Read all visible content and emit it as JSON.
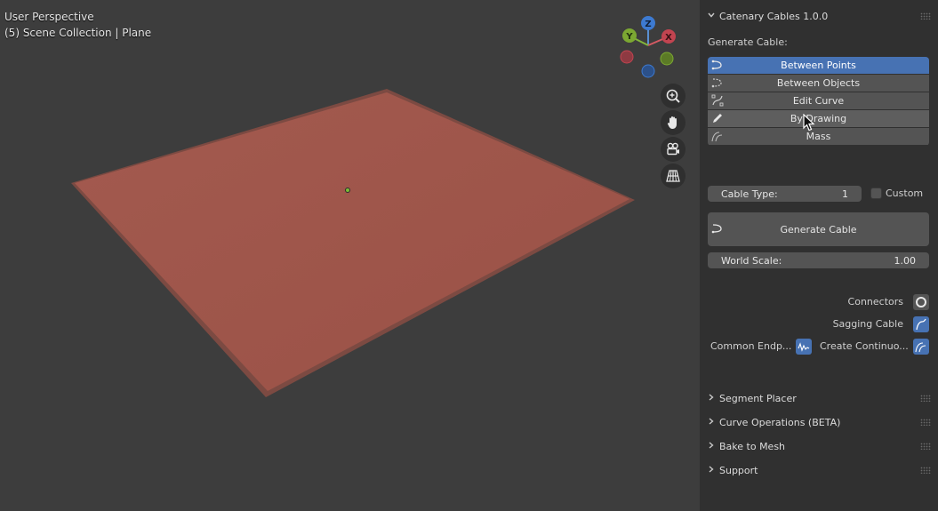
{
  "viewport": {
    "perspective_label": "User Perspective",
    "collection_label": "(5) Scene Collection | Plane",
    "gizmo": {
      "x_label": "X",
      "y_label": "Y",
      "z_label": "Z"
    },
    "nav_icons": [
      "zoom-icon",
      "hand-pan-icon",
      "camera-icon",
      "grid-ortho-icon"
    ]
  },
  "panel": {
    "title": "Catenary Cables 1.0.0",
    "generate_cable_label": "Generate Cable:",
    "modes": [
      {
        "label": "Between Points",
        "active": true,
        "icon": "cable-icon"
      },
      {
        "label": "Between Objects",
        "active": false,
        "icon": "cable-dashed-icon"
      },
      {
        "label": "Edit Curve",
        "active": false,
        "icon": "curve-edit-icon"
      },
      {
        "label": "By Drawing",
        "active": false,
        "icon": "pencil-icon"
      },
      {
        "label": "Mass",
        "active": false,
        "icon": "mass-icon"
      }
    ],
    "cable_type_label": "Cable Type:",
    "cable_type_value": "1",
    "custom_label": "Custom",
    "generate_button": "Generate Cable",
    "world_scale_label": "World Scale:",
    "world_scale_value": "1.00",
    "connectors_label": "Connectors",
    "sagging_label": "Sagging Cable",
    "common_endpoints_label": "Common Endp...",
    "create_continuous_label": "Create Continuo...",
    "sections": [
      "Segment Placer",
      "Curve Operations (BETA)",
      "Bake to Mesh",
      "Support"
    ]
  },
  "colors": {
    "accent": "#4772b3",
    "plane": "#b3594b",
    "background": "#3d3d3d",
    "panel": "#303030"
  }
}
